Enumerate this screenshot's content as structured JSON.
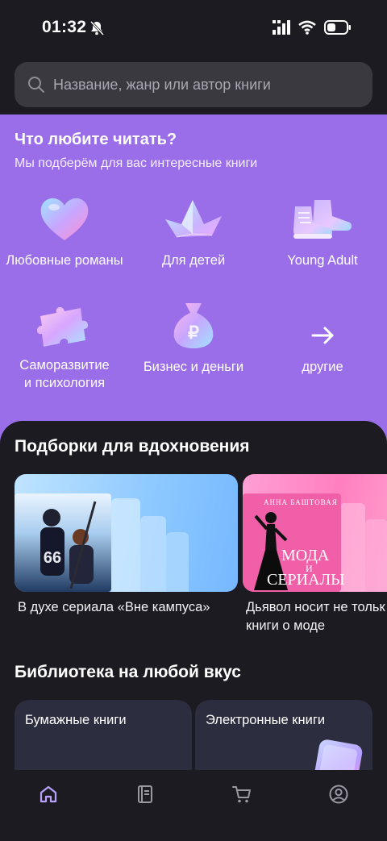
{
  "status_bar": {
    "time": "01:32"
  },
  "search": {
    "placeholder": "Название, жанр или автор книги"
  },
  "genres": {
    "title": "Что любите читать?",
    "subtitle": "Мы подберём для вас интересные книги",
    "items": [
      {
        "label": "Любовные романы",
        "icon": "heart-icon"
      },
      {
        "label": "Для детей",
        "icon": "paper-boat-icon"
      },
      {
        "label": "Young Adult",
        "icon": "sneakers-icon"
      },
      {
        "label_line1": "Саморазвитие",
        "label_line2": "и психология",
        "icon": "puzzle-icon"
      },
      {
        "label": "Бизнес и деньги",
        "icon": "money-bag-icon"
      },
      {
        "label": "другие",
        "icon": "arrow-right-icon"
      }
    ]
  },
  "collections": {
    "title": "Подборки для вдохновения",
    "items": [
      {
        "caption": "В духе сериала «Вне кампуса»"
      },
      {
        "caption_line1": "Дьявол носит не тольк",
        "caption_line2": "книги о моде",
        "book_author": "АННА БАШТОВАЯ",
        "book_title_1": "МОДА",
        "book_title_2": "И",
        "book_title_3": "СЕРИАЛЫ"
      }
    ]
  },
  "library": {
    "title": "Библиотека на любой вкус",
    "items": [
      {
        "label": "Бумажные книги"
      },
      {
        "label": "Электронные книги"
      }
    ]
  },
  "bottom_nav": {
    "items": [
      {
        "icon": "home-icon",
        "active": true
      },
      {
        "icon": "book-icon",
        "active": false
      },
      {
        "icon": "cart-icon",
        "active": false
      },
      {
        "icon": "profile-icon",
        "active": false
      }
    ]
  },
  "colors": {
    "accent": "#9a6ee9",
    "background": "#1c1b22",
    "active_nav": "#b9a2ff"
  }
}
